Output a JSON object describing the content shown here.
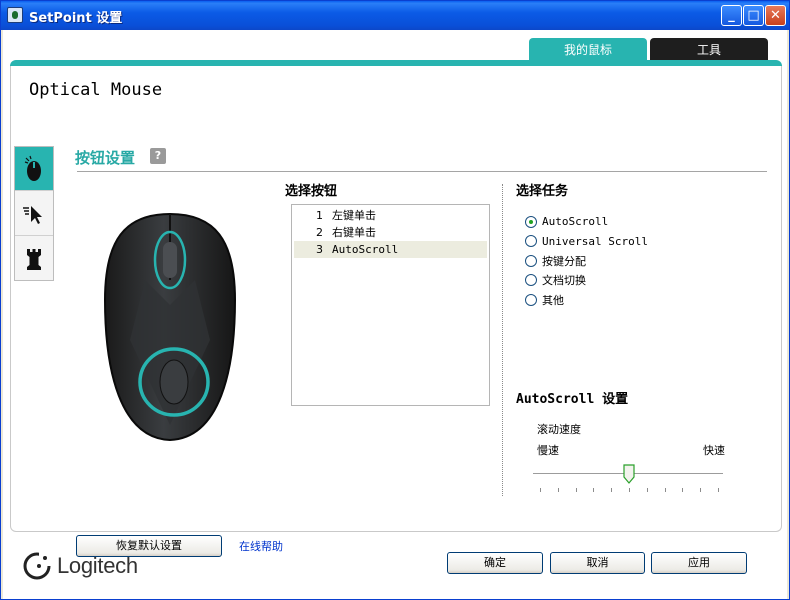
{
  "window": {
    "title": "SetPoint 设置",
    "min_glyph": "_",
    "max_glyph": "□",
    "close_glyph": "✕"
  },
  "tabs": [
    "我的鼠标",
    "工具"
  ],
  "device": {
    "name": "Optical Mouse"
  },
  "section": {
    "title": "按钮设置",
    "help_glyph": "?"
  },
  "select_button": {
    "heading": "选择按钮",
    "items": [
      {
        "num": "1",
        "label": "左键单击"
      },
      {
        "num": "2",
        "label": "右键单击"
      },
      {
        "num": "3",
        "label": "AutoScroll"
      }
    ],
    "selected_index": 2
  },
  "select_task": {
    "heading": "选择任务",
    "options": [
      "AutoScroll",
      "Universal Scroll",
      "按键分配",
      "文档切换",
      "其他"
    ],
    "selected_index": 0
  },
  "autoscroll": {
    "heading": "AutoScroll 设置",
    "speed_label": "滚动速度",
    "slow_label": "慢速",
    "fast_label": "快速",
    "speed_value": 0.5
  },
  "footer": {
    "restore_label": "恢复默认设置",
    "help_link": "在线帮助",
    "ok_label": "确定",
    "cancel_label": "取消",
    "apply_label": "应用"
  },
  "brand": {
    "logo_text": "Logitech"
  },
  "colors": {
    "accent": "#28b4b0",
    "dark_tab": "#1e1e1e",
    "link": "#0033cc"
  }
}
